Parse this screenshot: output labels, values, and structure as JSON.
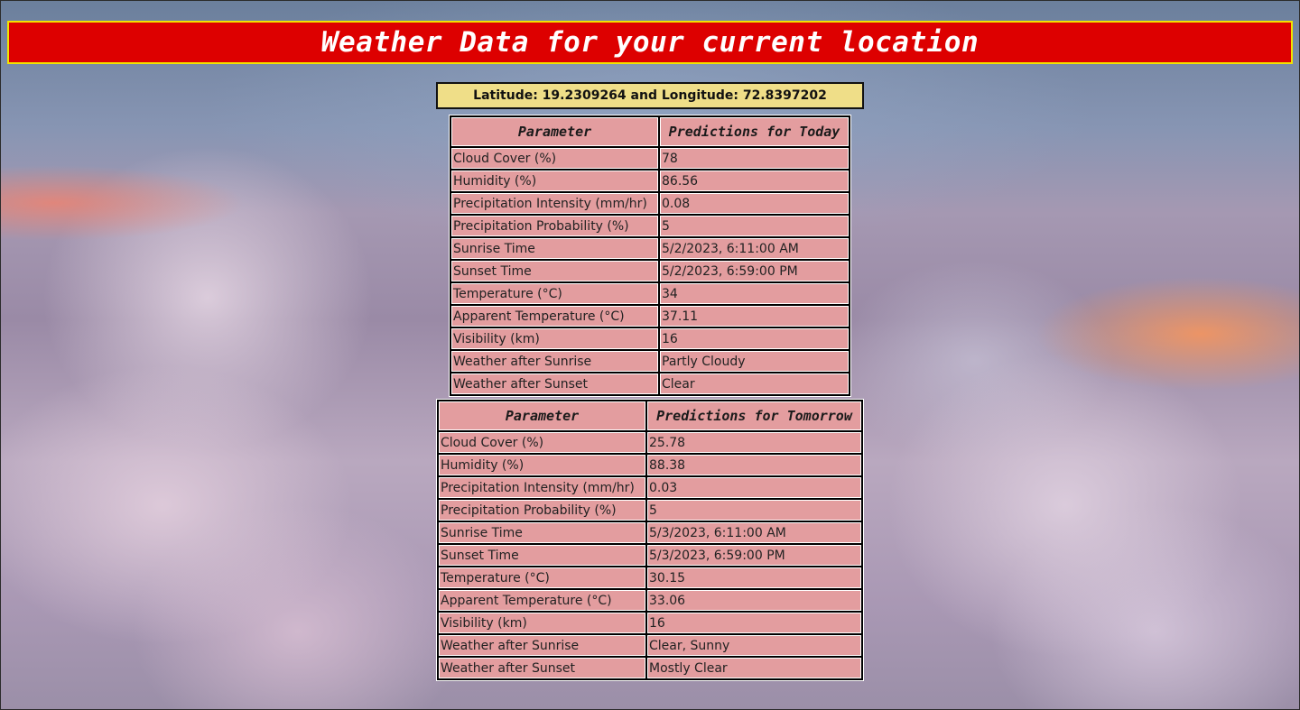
{
  "header": {
    "title": "Weather Data for your current location"
  },
  "location": {
    "text": "Latitude: 19.2309264 and Longitude: 72.8397202"
  },
  "today": {
    "headers": [
      "Parameter",
      "Predictions for Today"
    ],
    "rows": [
      [
        "Cloud Cover (%)",
        "78"
      ],
      [
        "Humidity (%)",
        "86.56"
      ],
      [
        "Precipitation Intensity (mm/hr)",
        "0.08"
      ],
      [
        "Precipitation Probability (%)",
        "5"
      ],
      [
        "Sunrise Time",
        "5/2/2023, 6:11:00 AM"
      ],
      [
        "Sunset Time",
        "5/2/2023, 6:59:00 PM"
      ],
      [
        "Temperature (°C)",
        "34"
      ],
      [
        "Apparent Temperature (°C)",
        "37.11"
      ],
      [
        "Visibility (km)",
        "16"
      ],
      [
        "Weather after Sunrise",
        "Partly Cloudy"
      ],
      [
        "Weather after Sunset",
        "Clear"
      ]
    ]
  },
  "tomorrow": {
    "headers": [
      "Parameter",
      "Predictions for Tomorrow"
    ],
    "rows": [
      [
        "Cloud Cover (%)",
        "25.78"
      ],
      [
        "Humidity (%)",
        "88.38"
      ],
      [
        "Precipitation Intensity (mm/hr)",
        "0.03"
      ],
      [
        "Precipitation Probability (%)",
        "5"
      ],
      [
        "Sunrise Time",
        "5/3/2023, 6:11:00 AM"
      ],
      [
        "Sunset Time",
        "5/3/2023, 6:59:00 PM"
      ],
      [
        "Temperature (°C)",
        "30.15"
      ],
      [
        "Apparent Temperature (°C)",
        "33.06"
      ],
      [
        "Visibility (km)",
        "16"
      ],
      [
        "Weather after Sunrise",
        "Clear, Sunny"
      ],
      [
        "Weather after Sunset",
        "Mostly Clear"
      ]
    ]
  },
  "colors": {
    "header_bg": "#dd0000",
    "header_border": "#f2e200",
    "coords_bg": "#efde88",
    "cell_bg": "#e39d9f"
  }
}
